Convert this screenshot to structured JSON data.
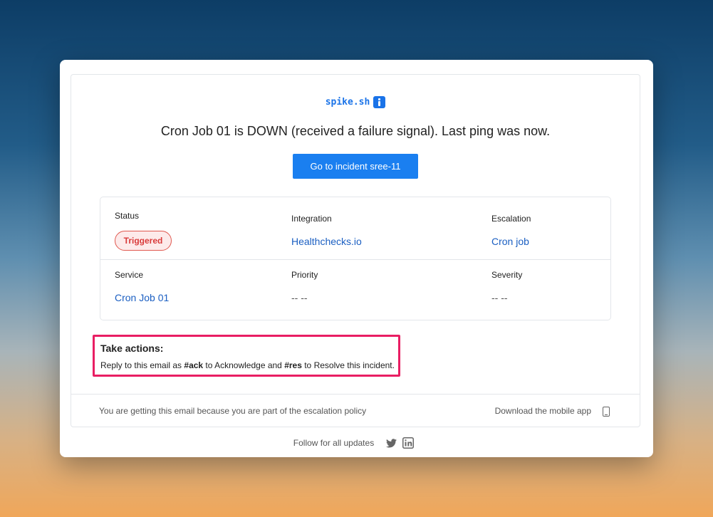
{
  "brand": {
    "name": "spike.sh",
    "icon": "info-icon"
  },
  "headline": "Cron Job 01 is DOWN (received a failure signal). Last ping was now.",
  "cta_label": "Go to incident sree-11",
  "details": {
    "status": {
      "label": "Status",
      "value": "Triggered"
    },
    "integration": {
      "label": "Integration",
      "value": "Healthchecks.io"
    },
    "escalation": {
      "label": "Escalation",
      "value": "Cron job"
    },
    "service": {
      "label": "Service",
      "value": "Cron Job 01"
    },
    "priority": {
      "label": "Priority",
      "value": "-- --"
    },
    "severity": {
      "label": "Severity",
      "value": "-- --"
    }
  },
  "actions": {
    "title": "Take actions:",
    "part1": "Reply to this email as ",
    "ack": "#ack",
    "part2": " to Acknowledge and ",
    "res": "#res",
    "part3": " to Resolve this incident."
  },
  "footer": {
    "left": "You are getting this email because you are part of the escalation policy",
    "right": "Download the mobile app",
    "right_icon": "mobile-phone-icon"
  },
  "follow": {
    "text": "Follow for all updates",
    "icons": [
      "twitter-icon",
      "linkedin-icon"
    ]
  },
  "colors": {
    "accent": "#1a7ff0",
    "link": "#1b5fc2",
    "triggered": "#d93b3b",
    "highlight_border": "#e91e63"
  }
}
